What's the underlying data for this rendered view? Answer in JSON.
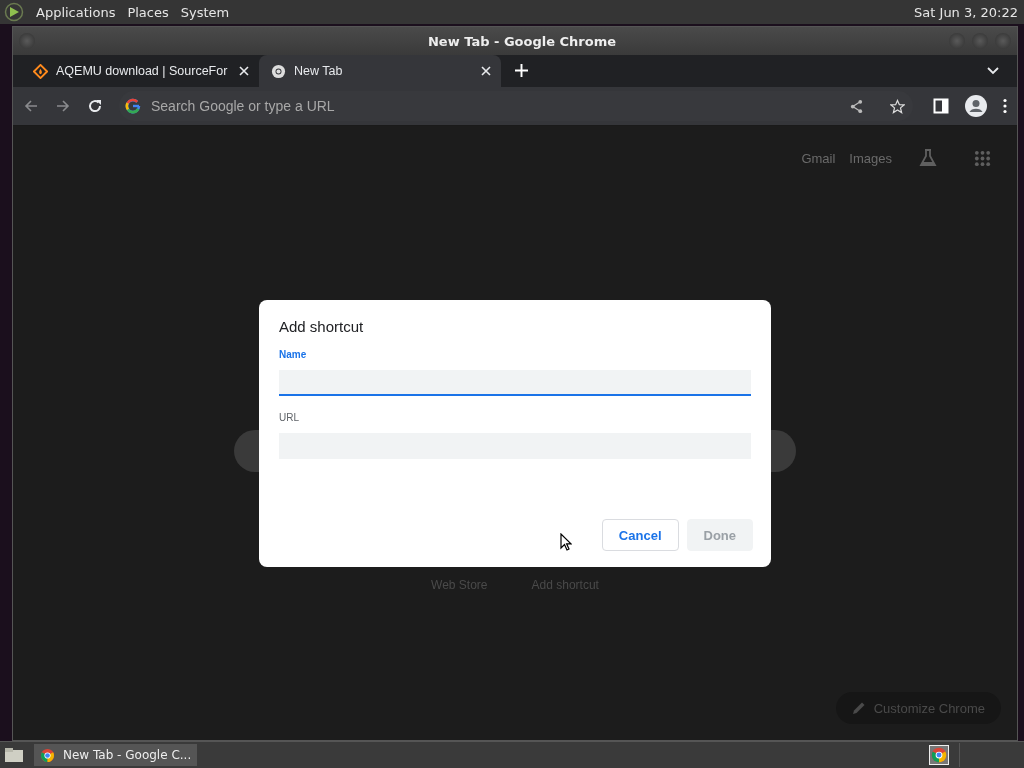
{
  "top_panel": {
    "menus": [
      "Applications",
      "Places",
      "System"
    ],
    "clock": "Sat Jun  3, 20:22"
  },
  "window": {
    "title": "New Tab - Google Chrome"
  },
  "tabs": [
    {
      "title": "AQEMU download | SourceFor",
      "kind": "site",
      "selected": false
    },
    {
      "title": "New Tab",
      "kind": "chrome",
      "selected": true
    }
  ],
  "omnibox": {
    "placeholder": "Search Google or type a URL"
  },
  "new_tab_page": {
    "links": [
      "Gmail",
      "Images"
    ],
    "shortcuts": [
      "Web Store",
      "Add shortcut"
    ],
    "customize_button": "Customize Chrome"
  },
  "dialog": {
    "title": "Add shortcut",
    "fields": [
      {
        "label": "Name",
        "focused": true
      },
      {
        "label": "URL",
        "focused": false
      }
    ],
    "buttons": [
      {
        "label": "Cancel",
        "disabled": false
      },
      {
        "label": "Done",
        "disabled": true
      }
    ]
  },
  "taskbar": {
    "tasks": [
      {
        "label": "New Tab - Google C..."
      }
    ]
  }
}
